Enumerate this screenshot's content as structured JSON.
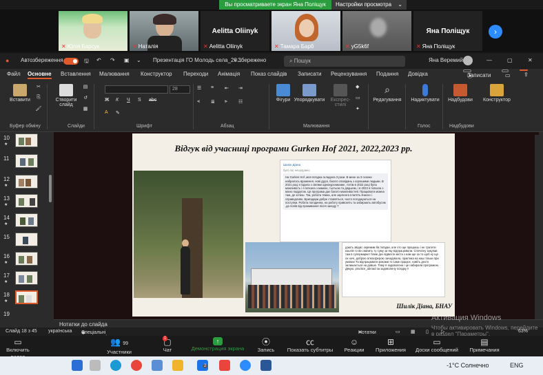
{
  "share_banner": {
    "viewing": "Вы просматриваете экран Яна Поліщук",
    "settings": "Настройки просмотра",
    "chevron": "chevron-down-icon"
  },
  "participants": [
    {
      "name": "Юлія Барсук",
      "muted": true
    },
    {
      "name": "Наталія",
      "muted": true
    },
    {
      "name": "Aelitta Oliinyk",
      "muted": true,
      "big_name": "Aelitta Oliinyk"
    },
    {
      "name": "Тамара Барб",
      "muted": true
    },
    {
      "name": "yG5k6f",
      "muted": true
    },
    {
      "name": "Яна Поліщук",
      "muted": true,
      "big_name": "Яна Поліщук"
    }
  ],
  "ppt": {
    "autosave_label": "Автозбереження",
    "doc_title": "Презентація ГО Молодь села_20...",
    "saved_status": "• Збережено",
    "search_placeholder": "Пошук",
    "user_name": "Яна Веремий",
    "menu": [
      "Файл",
      "Основне",
      "Вставлення",
      "Малювання",
      "Конструктор",
      "Переходи",
      "Анімація",
      "Показ слайдів",
      "Записати",
      "Рецензування",
      "Подання",
      "Довідка"
    ],
    "record_button": "Записати",
    "ribbon": {
      "paste": "Вставити",
      "new_slide_1": "Створити",
      "new_slide_2": "слайд",
      "shapes": "Фігури",
      "arrange": "Упорядкувати",
      "quick_styles_1": "Експрес-",
      "quick_styles_2": "стилі",
      "editing": "Редагування",
      "dictate": "Надиктувати",
      "addins": "Надбудови",
      "designer": "Конструктор",
      "font_size": "28",
      "groups": [
        "Буфер обміну",
        "Слайди",
        "Шрифт",
        "Абзац",
        "Малювання",
        "Голос",
        "Надбудови"
      ]
    },
    "thumbs": [
      {
        "num": "10"
      },
      {
        "num": "11"
      },
      {
        "num": "12"
      },
      {
        "num": "13"
      },
      {
        "num": "14"
      },
      {
        "num": "15"
      },
      {
        "num": "16"
      },
      {
        "num": "17"
      },
      {
        "num": "18"
      },
      {
        "num": "19"
      }
    ],
    "slide": {
      "title": "Відгук від учасниці програми Gurken Hof 2021, 2022,2023 рр.",
      "chat1_header": "Шилік Діана",
      "chat1_sub": "був(-ла) нещодавно",
      "chat1_text": "На Gurken Hof ,моя поїздка складала 3 рази. В мене за 3 сезони набралось враження, нові друзі, багато сповідань з хорошими людьми. В 2021 році я їздила з своїми однокурсниками , потім в 2022 році була можливість і я поїхала з мамою, тьотьою та дядьком, і в 2023 я поїхала з моєю подругою. Ця програма дає багато можливостей. Працювати можна там, де хочеш. Так, робота тяжка, але зарплата платять вчасно і справедливо. Бригадири добре ставляться, часто погоджуються на поступки. Робота погодинна, на роботу привозять та забирають автобусом ,до полів від проживання після заходу 7",
      "chat2_text": "дають звідкіс окремим бв поїздки, але хто ще працюєш і не тратити коштів то він змінить ту суму за яку відпрацювали. Спочатку закупав там в супермаркет ближ\nдех відвезти\nміста з нам ще за то щоб ну що ох ночі, доброю атмосферою зачарувала, практика на наш тільки при умовах Та відпрацювати роками то саме працює, навіть дехто залишається на довше. Тому я задоволена і це набирали програмою. Дякую. practice_abroad за задоволену поїздку !!",
      "signature": "Шилік Діана, БНАУ"
    },
    "notes_placeholder": "Нотатки до слайда",
    "status": {
      "slide_count": "Слайд 18 з 45",
      "language": "українська",
      "accessibility": "Спеціальні можливості: щось не так",
      "notes": "Нотатки",
      "zoom": "63%"
    }
  },
  "watermark": {
    "line1": "Активация Windows",
    "line2": "Чтобы активировать Windows, перейдите в раздел \"Параметры\"."
  },
  "zoom_toolbar": {
    "video": "Включить видео",
    "participants": "Участники",
    "participants_count": "99",
    "chat": "Чат",
    "chat_badge": "1",
    "share": "Демонстрация экрана",
    "record": "Запись",
    "captions": "Показать субтитры",
    "reactions": "Реакции",
    "apps": "Приложения",
    "whiteboards": "Доски сообщений",
    "notes": "Примечания"
  },
  "taskbar": {
    "weather": "-1°C Солнечно",
    "mail_badge": "2",
    "lang": "ENG"
  },
  "colors": {
    "accent_orange": "#e05a2b",
    "zoom_green": "#2a9d3e",
    "zoom_blue": "#2d8cff"
  }
}
